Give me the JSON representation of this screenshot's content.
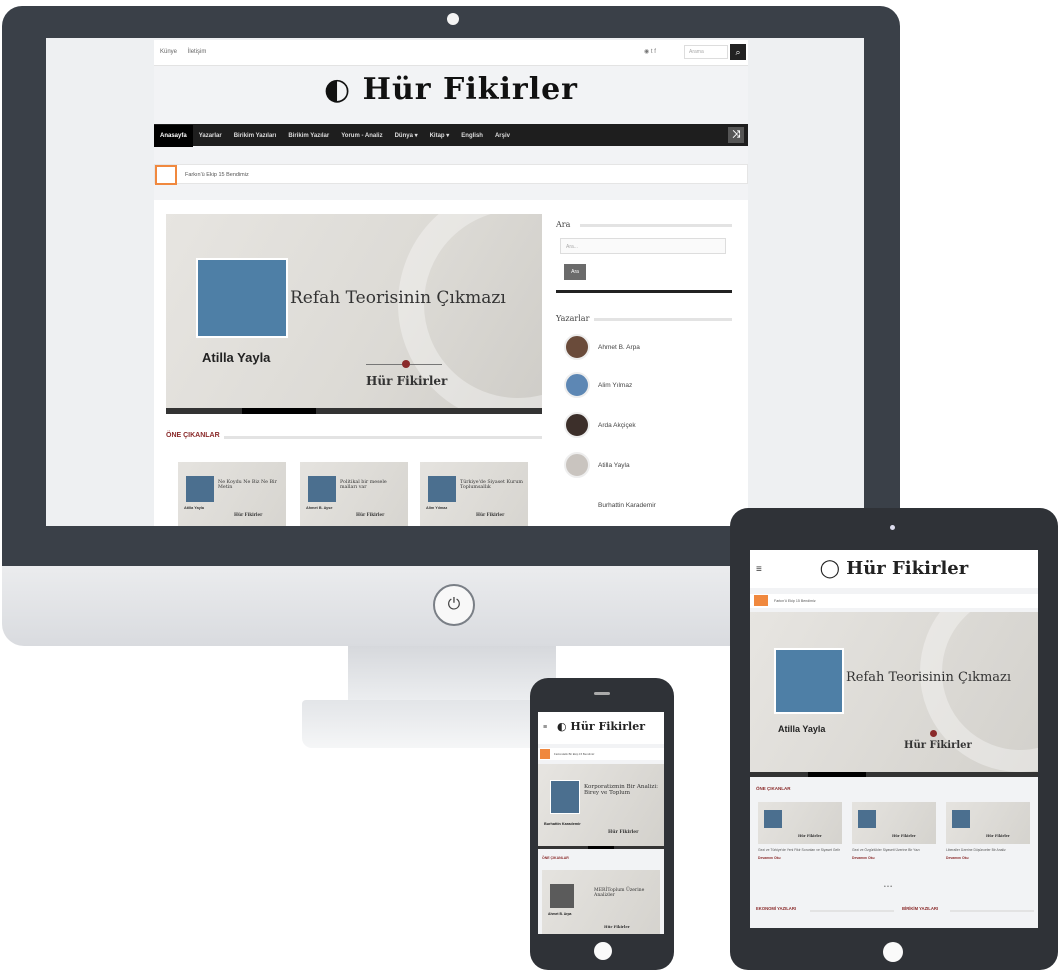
{
  "desktop": {
    "top_links": [
      "Künye",
      "İletişim"
    ],
    "social_icons": [
      "rss-icon",
      "twitter-icon",
      "facebook-icon"
    ],
    "search_placeholder": "Arama",
    "logo": "Hür Fikirler",
    "nav": [
      "Anasayfa",
      "Yazarlar",
      "Birikim Yazıları",
      "Birikim Yazılar",
      "Yorum - Analiz",
      "Dünya ▾",
      "Kitap ▾",
      "English",
      "Arşiv"
    ],
    "ticker_text": "Farkın'ü Ekip 15 Bendimiz",
    "slider": {
      "title": "Refah Teorisinin Çıkmazı",
      "author": "Atilla Yayla",
      "brand": "Hür Fikirler"
    },
    "featured_label": "ÖNE ÇIKANLAR",
    "featured_cards": [
      {
        "title": "Ne Koydu Ne Biz Ne Bir Metin",
        "name": "Atilla Yayla",
        "brand": "Hür Fikirler"
      },
      {
        "title": "Politikal bir mesele malları var",
        "name": "Ahmet B. Ayse",
        "brand": "Hür Fikirler"
      },
      {
        "title": "Türkiye'de Siyaset Kurum Toplumsallık",
        "name": "Alim Yılmaz",
        "brand": "Hür Fikirler"
      }
    ],
    "sidebar": {
      "search_label": "Ara",
      "search_placeholder": "Ara...",
      "search_button": "Ara",
      "authors_label": "Yazarlar",
      "authors": [
        "Ahmet B. Arpa",
        "Alim Yılmaz",
        "Arda Akçiçek",
        "Atilla Yayla",
        "Burhattin Karademir"
      ]
    }
  },
  "tablet": {
    "logo": "Hür Fikirler",
    "ticker_text": "Farkın'ü Ekip 15 Bendimiz",
    "slider": {
      "title": "Refah Teorisinin Çıkmazı",
      "author": "Atilla Yayla",
      "brand": "Hür Fikirler"
    },
    "featured_label": "ÖNE ÇIKANLAR",
    "cards": [
      {
        "brand": "Hür Fikirler",
        "text": "Gezi ve Türkiye'de Yeni Fikir Sorunları ve Siyaset Gelir",
        "more": "Devamını Oku"
      },
      {
        "brand": "Hür Fikirler",
        "text": "Gezi ve Özgürlükler Siyaseti Üzerine Bir Yazı",
        "more": "Devamını Oku"
      },
      {
        "brand": "Hür Fikirler",
        "text": "Liberaller Üzerine Düşünceler Bir Analiz",
        "more": "Devamını Oku"
      }
    ],
    "dots": "• • •",
    "sections": [
      "EKONOMİ YAZILARI",
      "BİRİKİM YAZILARI"
    ]
  },
  "phone": {
    "logo": "Hür Fikirler",
    "ticker_text": "Farkındalık Bir Ekip 15 Bendimiz",
    "slider": {
      "title": "Korporatizmin Bir Analizi: Birey ve Toplum",
      "author": "Burhattin Karademir",
      "brand": "Hür Fikirler"
    },
    "featured_label": "ÖNE ÇIKANLAR",
    "card": {
      "title": "MERİToplum Üzerine Analizler",
      "author": "Ahmet B. Arpa",
      "brand": "Hür Fikirler"
    }
  }
}
